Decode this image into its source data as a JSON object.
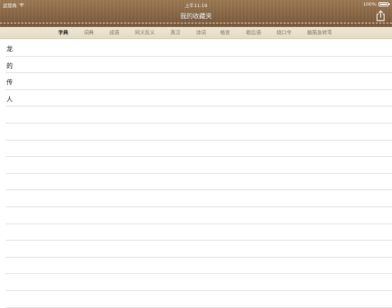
{
  "status": {
    "carrier": "运营商",
    "time": "上午11:19",
    "battery": "100%"
  },
  "header": {
    "title": "我的收藏夹",
    "share_icon": "share-icon"
  },
  "tabs": [
    {
      "label": "字典",
      "active": true
    },
    {
      "label": "词典",
      "active": false
    },
    {
      "label": "成语",
      "active": false
    },
    {
      "label": "同义反义",
      "active": false
    },
    {
      "label": "英汉",
      "active": false
    },
    {
      "label": "诗词",
      "active": false
    },
    {
      "label": "格言",
      "active": false
    },
    {
      "label": "歇后语",
      "active": false
    },
    {
      "label": "绕口令",
      "active": false
    },
    {
      "label": "脑筋急转弯",
      "active": false
    }
  ],
  "favorites": [
    "龙",
    "的",
    "传",
    "人",
    "",
    "",
    "",
    "",
    "",
    "",
    "",
    "",
    "",
    "",
    "",
    ""
  ]
}
